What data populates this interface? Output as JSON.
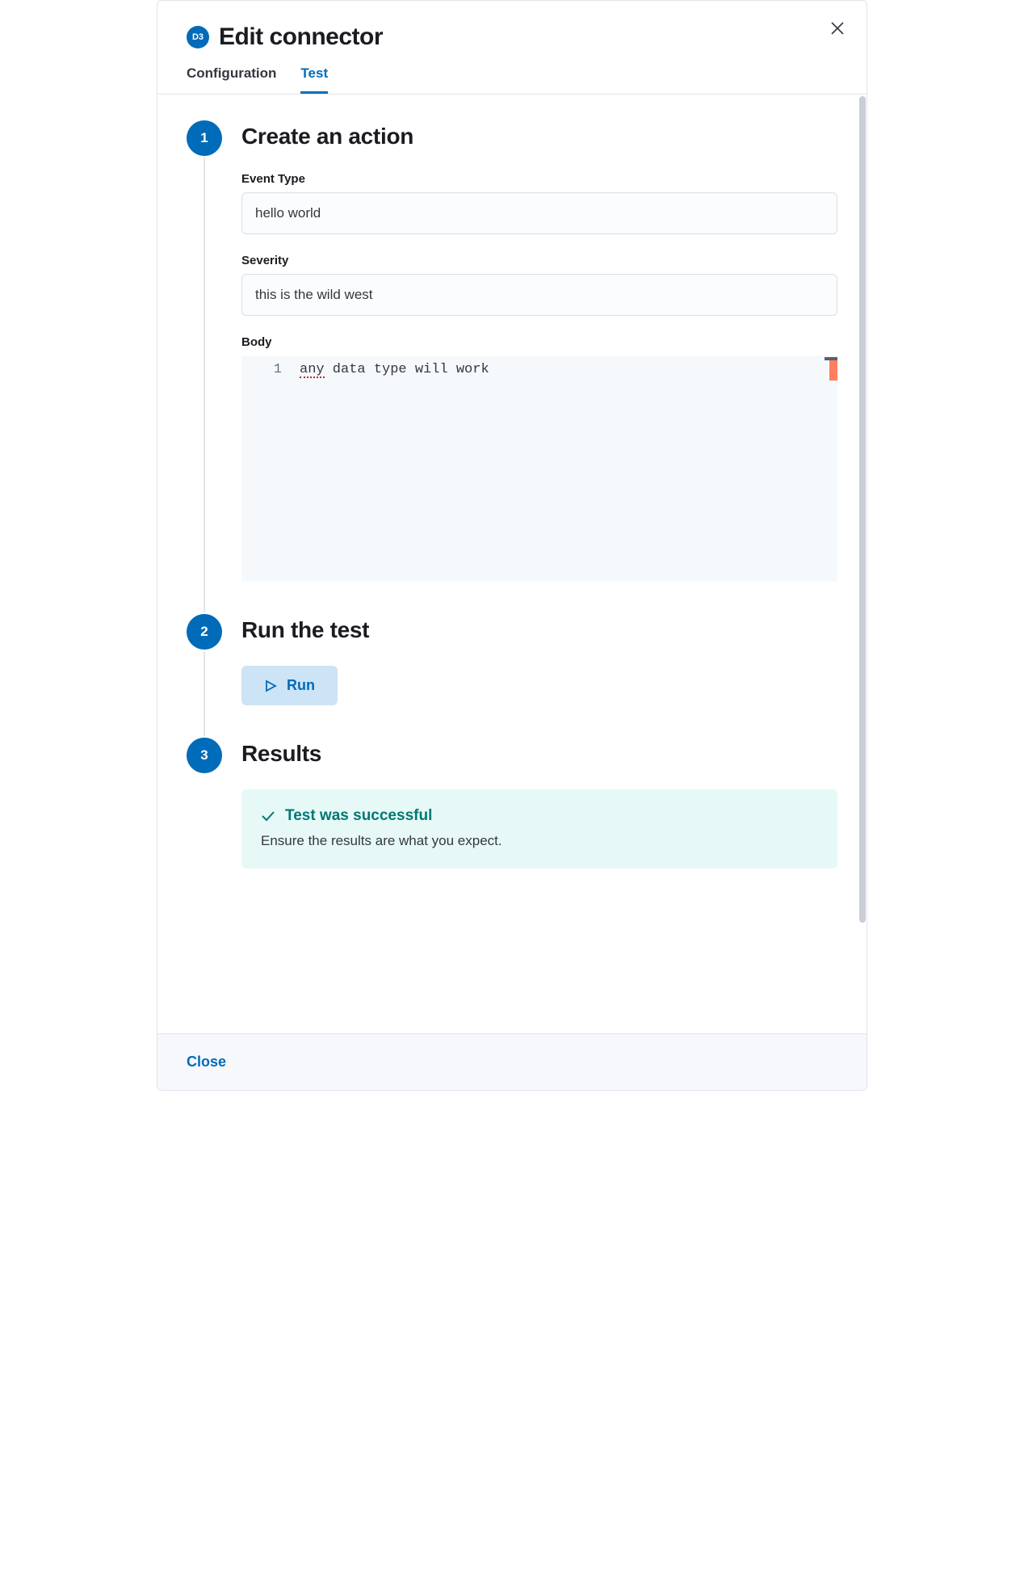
{
  "header": {
    "logo_text": "D3",
    "title": "Edit connector"
  },
  "tabs": [
    {
      "label": "Configuration",
      "active": false
    },
    {
      "label": "Test",
      "active": true
    }
  ],
  "steps": {
    "create": {
      "number": "1",
      "title": "Create an action",
      "fields": {
        "event_type_label": "Event Type",
        "event_type_value": "hello world",
        "severity_label": "Severity",
        "severity_value": "this is the wild west",
        "body_label": "Body",
        "body_line_number": "1",
        "body_underlined_token": "any",
        "body_rest": " data type will work"
      }
    },
    "run": {
      "number": "2",
      "title": "Run the test",
      "button_label": "Run"
    },
    "results": {
      "number": "3",
      "title": "Results",
      "success_title": "Test was successful",
      "success_desc": "Ensure the results are what you expect."
    }
  },
  "footer": {
    "close": "Close"
  }
}
